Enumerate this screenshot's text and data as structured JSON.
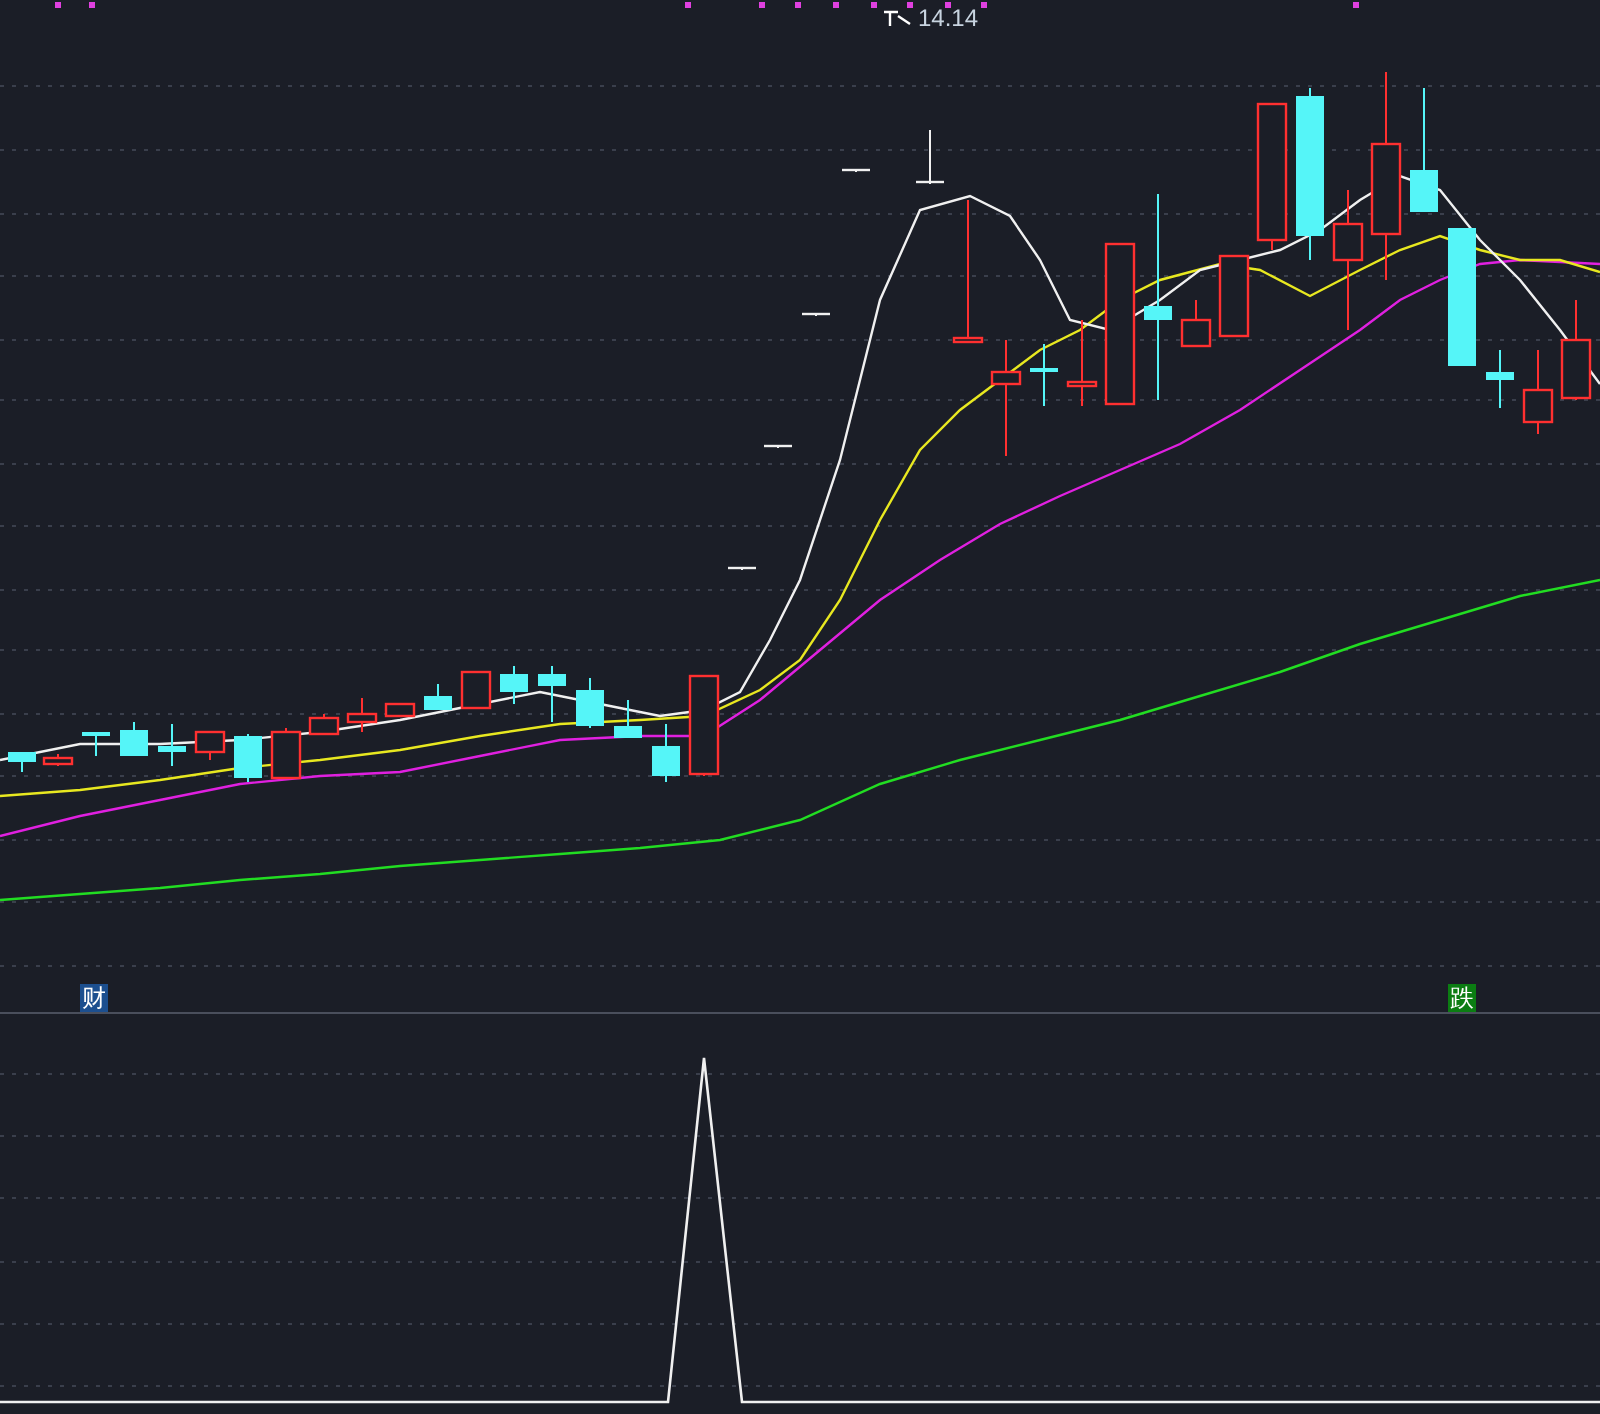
{
  "price_panel": {
    "high_marker": "14.14"
  },
  "signal_labels": [
    {
      "text": "财",
      "color": "#1c4f8f"
    },
    {
      "text": "跌",
      "color": "#0b7d12"
    }
  ]
}
